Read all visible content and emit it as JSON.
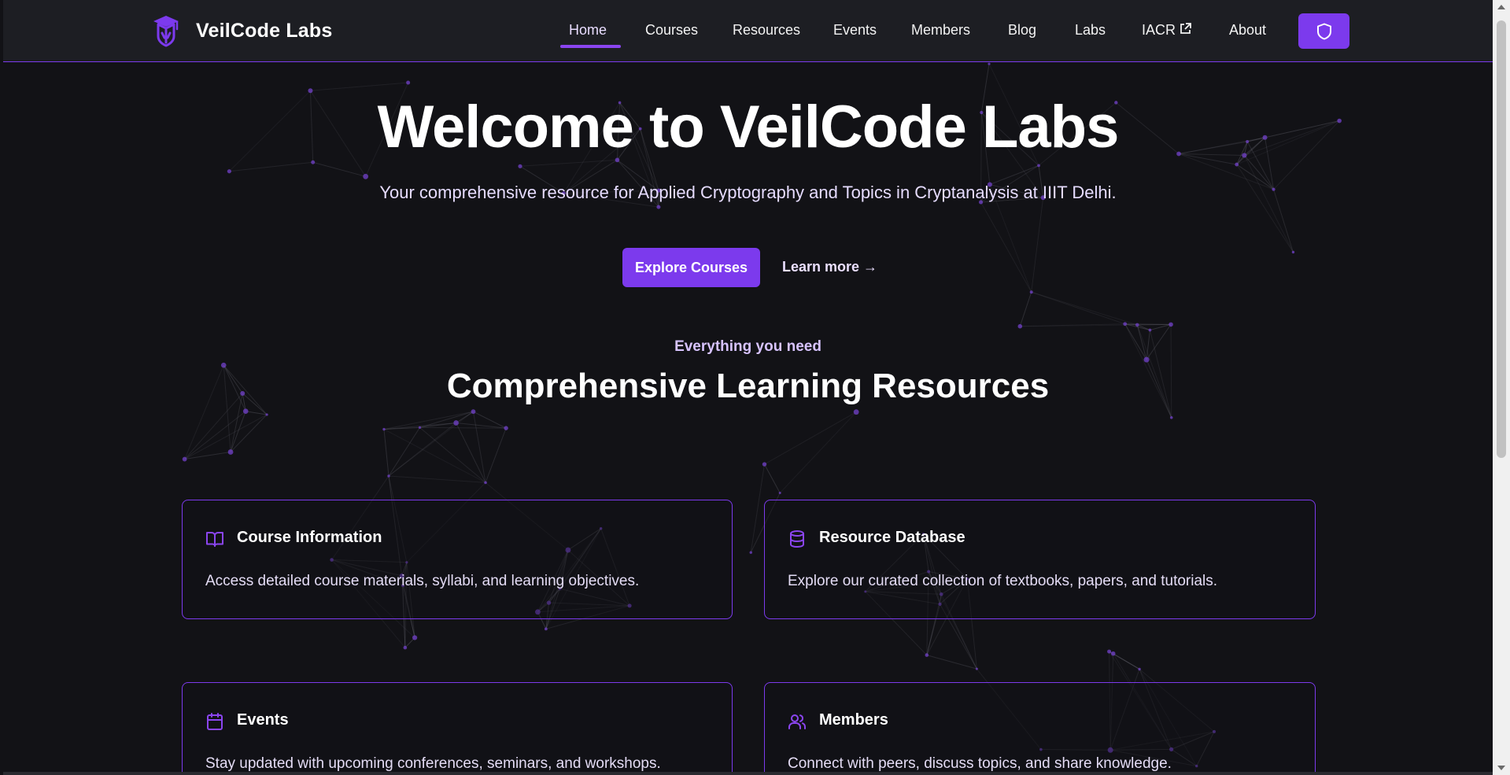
{
  "brand": {
    "name": "VeilCode Labs",
    "logo_icon": "graduation-shield-icon"
  },
  "nav": {
    "items": [
      {
        "label": "Home",
        "active": true
      },
      {
        "label": "Courses"
      },
      {
        "label": "Resources"
      },
      {
        "label": "Events"
      },
      {
        "label": "Members"
      },
      {
        "label": "Blog"
      },
      {
        "label": "Labs"
      },
      {
        "label": "IACR",
        "external_icon": "external-link-icon"
      },
      {
        "label": "About"
      }
    ],
    "action_icon": "shield-icon"
  },
  "hero": {
    "title": "Welcome to VeilCode Labs",
    "subtitle": "Your comprehensive resource for Applied Cryptography and Topics in Cryptanalysis at IIIT Delhi.",
    "primary_button": "Explore Courses",
    "secondary_link": "Learn more →"
  },
  "features": {
    "eyebrow": "Everything you need",
    "title": "Comprehensive Learning Resources",
    "cards": [
      {
        "title": "Course Information",
        "description": "Access detailed course materials, syllabi, and learning objectives.",
        "icon": "book-open-icon"
      },
      {
        "title": "Resource Database",
        "description": "Explore our curated collection of textbooks, papers, and tutorials.",
        "icon": "database-icon"
      },
      {
        "title": "Events",
        "description": "Stay updated with upcoming conferences, seminars, and workshops.",
        "icon": "calendar-icon"
      },
      {
        "title": "Members",
        "description": "Connect with peers, discuss topics, and share knowledge.",
        "icon": "users-icon"
      }
    ]
  },
  "colors": {
    "background": "#121216",
    "header": "#1d1e23",
    "accent": "#7c3aed",
    "accent_light": "#d7c3ff"
  }
}
